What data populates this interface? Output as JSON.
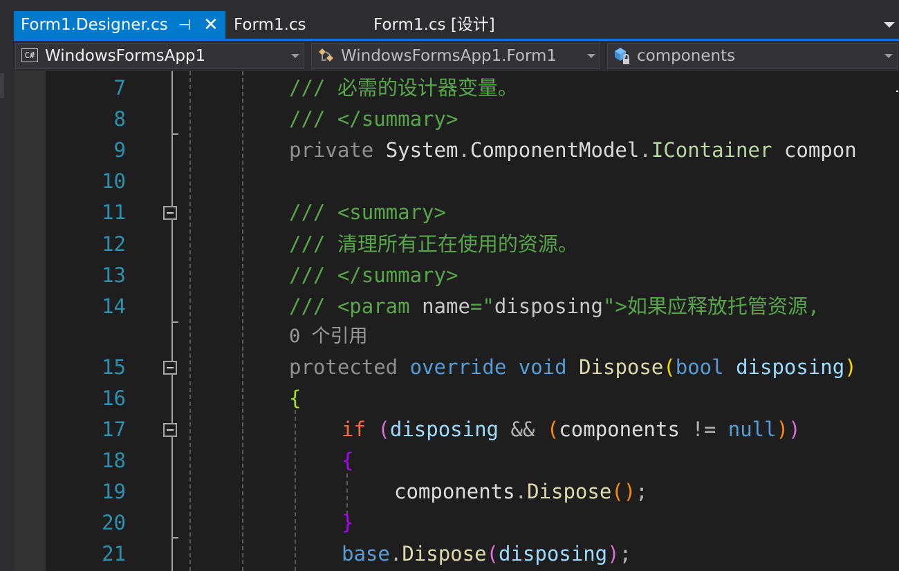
{
  "tabs": {
    "designer_label": "Form1.Designer.cs",
    "pin_glyph": "⊣",
    "close_glyph": "✕",
    "form1_label": "Form1.cs",
    "form1_design_label": "Form1.cs [设计]"
  },
  "navbar": {
    "project": "WindowsFormsApp1",
    "project_icon_text": "C#",
    "type": "WindowsFormsApp1.Form1",
    "member": "components"
  },
  "editor": {
    "line_numbers": [
      "7",
      "8",
      "9",
      "10",
      "11",
      "12",
      "13",
      "14",
      "15",
      "16",
      "17",
      "18",
      "19",
      "20",
      "21"
    ],
    "codelens": "0 个引用",
    "lines": {
      "l7": [
        {
          "t": "/// ",
          "c": "#57a64a"
        },
        {
          "t": "必需的设计器变量。",
          "c": "#57a64a"
        }
      ],
      "l8": [
        {
          "t": "/// ",
          "c": "#57a64a"
        },
        {
          "t": "</summary>",
          "c": "#57a64a"
        }
      ],
      "l9": [
        {
          "t": "private ",
          "c": "#909090"
        },
        {
          "t": "System",
          "c": "#dcdcdc"
        },
        {
          "t": ".",
          "c": "#b4b4b4"
        },
        {
          "t": "ComponentModel",
          "c": "#dcdcdc"
        },
        {
          "t": ".",
          "c": "#b4b4b4"
        },
        {
          "t": "IContainer",
          "c": "#b8d7a3"
        },
        {
          "t": " compon",
          "c": "#dcdcdc"
        }
      ],
      "l11": [
        {
          "t": "/// ",
          "c": "#57a64a"
        },
        {
          "t": "<summary>",
          "c": "#57a64a"
        }
      ],
      "l12": [
        {
          "t": "/// ",
          "c": "#57a64a"
        },
        {
          "t": "清理所有正在使用的资源。",
          "c": "#57a64a"
        }
      ],
      "l13": [
        {
          "t": "/// ",
          "c": "#57a64a"
        },
        {
          "t": "</summary>",
          "c": "#57a64a"
        }
      ],
      "l14": [
        {
          "t": "/// ",
          "c": "#57a64a"
        },
        {
          "t": "<param ",
          "c": "#57a64a"
        },
        {
          "t": "name",
          "c": "#c8c8c8"
        },
        {
          "t": "=\"",
          "c": "#57a64a"
        },
        {
          "t": "disposing",
          "c": "#c8c8c8"
        },
        {
          "t": "\">",
          "c": "#57a64a"
        },
        {
          "t": "如果应释放托管资源,",
          "c": "#57a64a"
        }
      ],
      "l15": [
        {
          "t": "protected ",
          "c": "#909090"
        },
        {
          "t": "override ",
          "c": "#569cd6"
        },
        {
          "t": "void ",
          "c": "#569cd6"
        },
        {
          "t": "Dispose",
          "c": "#dcdcaa"
        },
        {
          "t": "(",
          "c": "#ffd700"
        },
        {
          "t": "bool ",
          "c": "#569cd6"
        },
        {
          "t": "disposing",
          "c": "#9cdcfe"
        },
        {
          "t": ")",
          "c": "#ffd700"
        }
      ],
      "l16": [
        {
          "t": "{",
          "c": "#a6e22e"
        }
      ],
      "l17": [
        {
          "t": "if ",
          "c": "#ff6a3d"
        },
        {
          "t": "(",
          "c": "#da70d6"
        },
        {
          "t": "disposing",
          "c": "#9cdcfe"
        },
        {
          "t": " && ",
          "c": "#b4b4b4"
        },
        {
          "t": "(",
          "c": "#ff8c00"
        },
        {
          "t": "components",
          "c": "#dcdcdc"
        },
        {
          "t": " != ",
          "c": "#b4b4b4"
        },
        {
          "t": "null",
          "c": "#569cd6"
        },
        {
          "t": ")",
          "c": "#ff8c00"
        },
        {
          "t": ")",
          "c": "#da70d6"
        }
      ],
      "l18": [
        {
          "t": "{",
          "c": "#b000ff"
        }
      ],
      "l19": [
        {
          "t": "components",
          "c": "#dcdcdc"
        },
        {
          "t": ".",
          "c": "#b4b4b4"
        },
        {
          "t": "Dispose",
          "c": "#dcdcaa"
        },
        {
          "t": "()",
          "c": "#ff8c00"
        },
        {
          "t": ";",
          "c": "#b4b4b4"
        }
      ],
      "l20": [
        {
          "t": "}",
          "c": "#b000ff"
        }
      ],
      "l21": [
        {
          "t": "base",
          "c": "#569cd6"
        },
        {
          "t": ".",
          "c": "#b4b4b4"
        },
        {
          "t": "Dispose",
          "c": "#dcdcaa"
        },
        {
          "t": "(",
          "c": "#da70d6"
        },
        {
          "t": "disposing",
          "c": "#9cdcfe"
        },
        {
          "t": ")",
          "c": "#da70d6"
        },
        {
          "t": ";",
          "c": "#b4b4b4"
        }
      ]
    }
  },
  "colors": {
    "accent": "#007acc",
    "line_number": "#2b91af",
    "comment": "#57a64a",
    "keyword": "#569cd6",
    "background": "#1e1e1e"
  }
}
